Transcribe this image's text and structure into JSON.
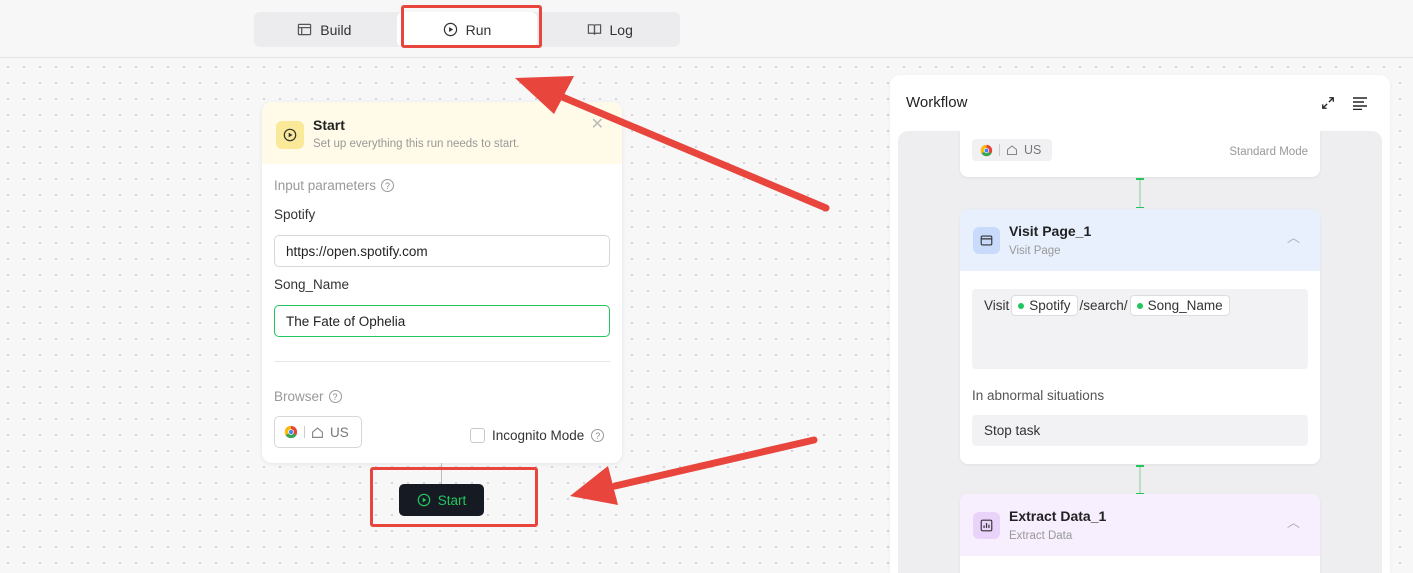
{
  "tabs": [
    {
      "label": "Build",
      "icon": "build-icon"
    },
    {
      "label": "Run",
      "icon": "play-circle-icon",
      "active": true
    },
    {
      "label": "Log",
      "icon": "book-icon"
    }
  ],
  "start_panel": {
    "title": "Start",
    "subtitle": "Set up everything this run needs to start.",
    "input_params_label": "Input parameters",
    "fields": [
      {
        "label": "Spotify",
        "value": "https://open.spotify.com"
      },
      {
        "label": "Song_Name",
        "value": "The Fate of Ophelia"
      }
    ],
    "browser_label": "Browser",
    "browser_region": "US",
    "incognito_label": "Incognito Mode",
    "incognito_checked": false,
    "start_button": "Start"
  },
  "workflow": {
    "title": "Workflow",
    "top_card": {
      "region": "US",
      "mode": "Standard Mode"
    },
    "visit_card": {
      "title": "Visit Page_1",
      "subtitle": "Visit Page",
      "visit_word": "Visit",
      "var1": "Spotify",
      "path_mid": "/search/",
      "var2": "Song_Name",
      "abnormal_label": "In abnormal situations",
      "abnormal_action": "Stop task"
    },
    "extract_card": {
      "title": "Extract Data_1",
      "subtitle": "Extract Data"
    }
  },
  "colors": {
    "accent": "#22c55e",
    "annotation": "#e8453c",
    "dark_button": "#151a23"
  }
}
